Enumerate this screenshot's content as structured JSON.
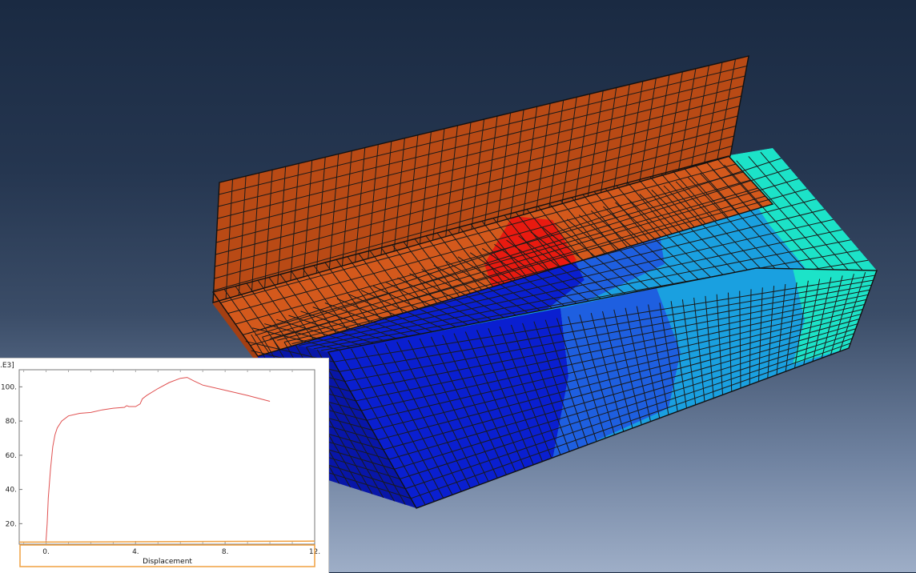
{
  "viewport": {
    "mesh_colors": {
      "shell": "#c9501a",
      "shell_dark": "#a53f12",
      "stress_high": "#e81a10",
      "deep_blue": "#0a1fd0",
      "mid_blue": "#1e5fe0",
      "light_blue": "#1aa0e0",
      "cyan": "#1ce3c8",
      "edge": "#1a1a1a"
    }
  },
  "plot": {
    "y_unit_label": ".E3]",
    "x_axis_title": "Displacement",
    "line_color": "#e05050",
    "highlight_color": "#f0a040",
    "chart_data": {
      "type": "line",
      "xlabel": "Displacement",
      "ylabel": "",
      "xlim": [
        -1.2,
        12
      ],
      "ylim": [
        8,
        110
      ],
      "x_ticks": [
        "0.",
        "4.",
        "8.",
        "12."
      ],
      "y_ticks": [
        "20.",
        "40.",
        "60.",
        "80.",
        "100."
      ],
      "y_tick_values": [
        20,
        40,
        60,
        80,
        100
      ],
      "x_tick_values": [
        0,
        4,
        8,
        12
      ],
      "series": [
        {
          "x": [
            0.0,
            0.05,
            0.1,
            0.2,
            0.3,
            0.4,
            0.5,
            0.7,
            1.0,
            1.5,
            2.0,
            2.5,
            3.0,
            3.5,
            3.6,
            3.7,
            4.0,
            4.2,
            4.3,
            4.5,
            5.0,
            5.5,
            6.0,
            6.3,
            6.6,
            7.0,
            8.0,
            9.0,
            10.0
          ],
          "y": [
            10,
            20,
            35,
            52,
            65,
            72,
            76,
            80,
            83,
            84.5,
            85,
            86.5,
            87.5,
            88,
            89,
            88.5,
            88.5,
            90,
            93,
            95,
            99,
            102.5,
            105,
            105.5,
            103.5,
            101,
            98,
            95,
            91.5
          ]
        }
      ]
    }
  }
}
